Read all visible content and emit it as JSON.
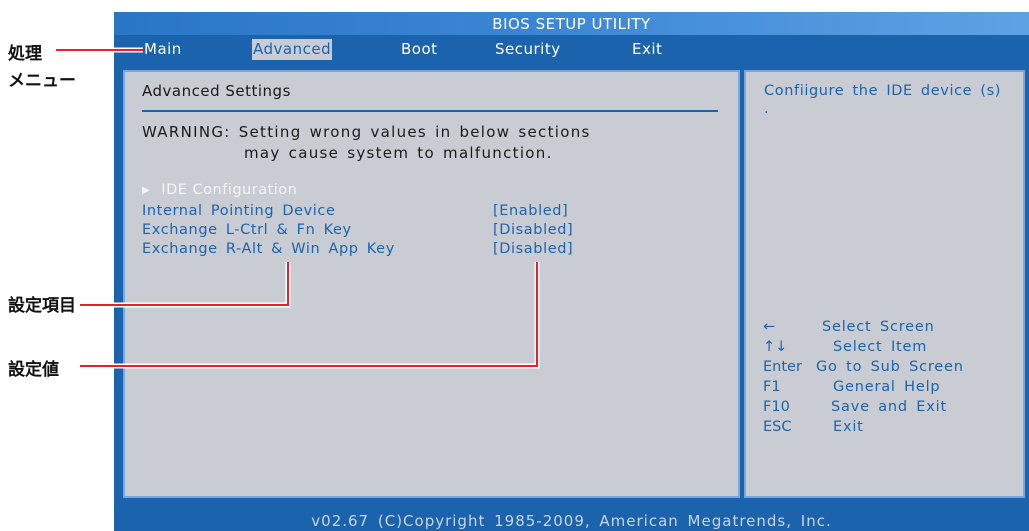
{
  "bios": {
    "title": "BIOS SETUP UTILITY",
    "menu": [
      {
        "label": "Main",
        "selected": false
      },
      {
        "label": "Advanced",
        "selected": true
      },
      {
        "label": "Boot",
        "selected": false
      },
      {
        "label": "Security",
        "selected": false
      },
      {
        "label": "Exit",
        "selected": false
      }
    ],
    "section_title": "Advanced Settings",
    "warning_line1": "WARNING: Setting wrong values in below sections",
    "warning_line2": "may cause system to malfunction.",
    "ide_config_label": " IDE Configuration",
    "settings": [
      {
        "label": "Internal Pointing Device",
        "value": "[Enabled]"
      },
      {
        "label": "Exchange L-Ctrl & Fn Key",
        "value": "[Disabled]"
      },
      {
        "label": "Exchange R-Alt & Win App Key",
        "value": "[Disabled]"
      }
    ],
    "help_text": "Confiigure the IDE device (s) .",
    "keys": [
      {
        "key": "←",
        "desc": "Select Screen"
      },
      {
        "key": "↑↓",
        "desc": "Select Item"
      },
      {
        "key": "Enter",
        "desc": "Go to Sub Screen"
      },
      {
        "key": "F1",
        "desc": "General Help"
      },
      {
        "key": "F10",
        "desc": "Save and Exit"
      },
      {
        "key": "ESC",
        "desc": "Exit"
      }
    ],
    "footer": "v02.67 (C)Copyright 1985-2009, American Megatrends, Inc."
  },
  "annotations": {
    "menu_label_line1": "処理",
    "menu_label_line2": "メニュー",
    "setting_item_label": "設定項目",
    "setting_value_label": "設定値"
  },
  "colors": {
    "bios_blue": "#1c63ae",
    "panel_gray": "#c9cdd3",
    "callout_red": "#e8202a"
  }
}
